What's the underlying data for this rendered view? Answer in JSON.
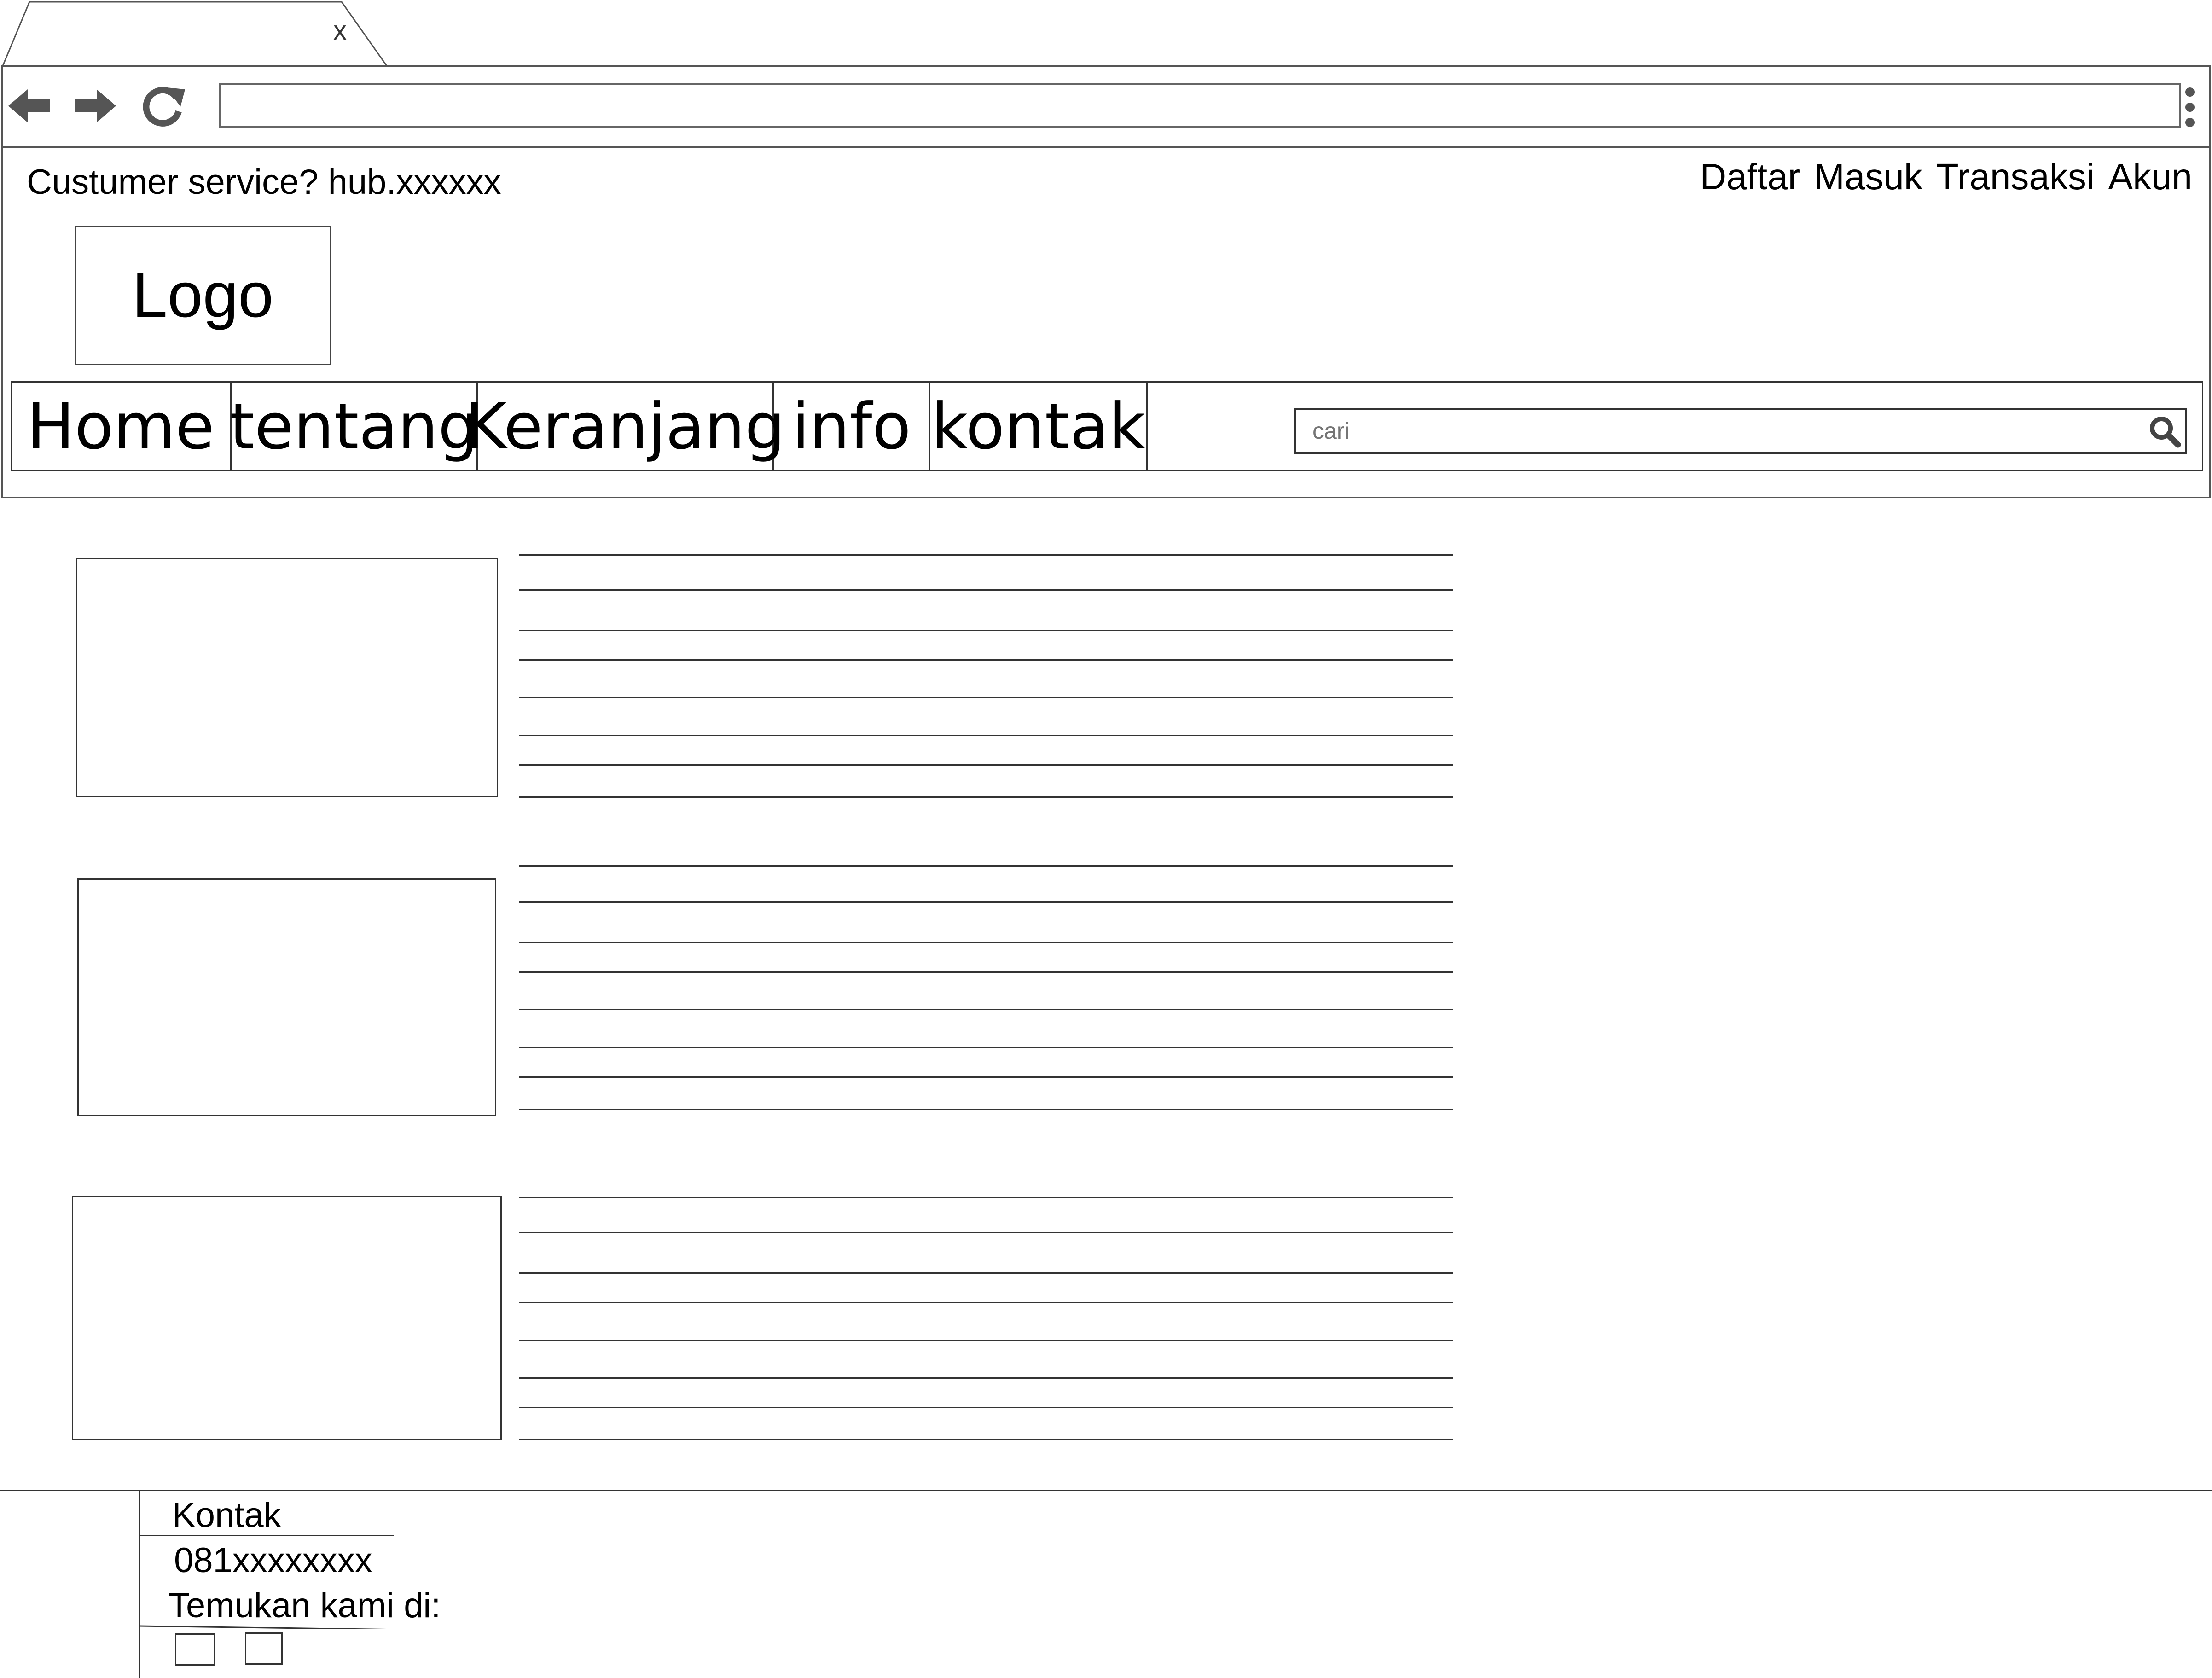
{
  "browser": {
    "tab_close": "x",
    "address": ""
  },
  "header": {
    "customer_service": "Custumer service? hub.xxxxxx",
    "links": [
      "Daftar",
      "Masuk",
      "Transaksi",
      "Akun"
    ],
    "logo": "Logo"
  },
  "nav": {
    "items": [
      "Home",
      "tentang",
      "Keranjang",
      "info",
      "kontak"
    ],
    "search_placeholder": "cari"
  },
  "content": {
    "articles": [
      {
        "lines": 8
      },
      {
        "lines": 8
      },
      {
        "lines": 8
      }
    ]
  },
  "footer": {
    "heading": "Kontak",
    "phone": "081xxxxxxxx",
    "find_us": "Temukan kami di:"
  },
  "icons": {
    "back": "arrow-left-icon",
    "forward": "arrow-right-icon",
    "reload": "reload-icon",
    "menu": "kebab-menu-icon",
    "search": "search-icon"
  }
}
